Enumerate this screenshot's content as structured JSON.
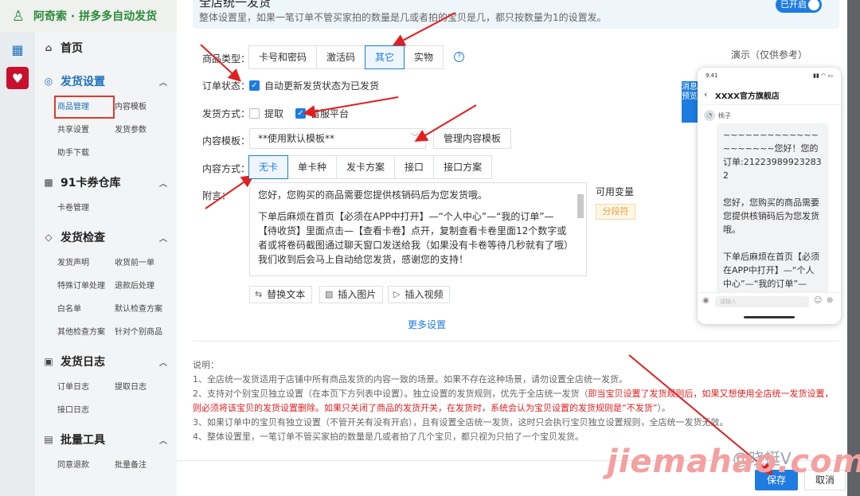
{
  "app": {
    "title": "阿奇索 · 拼多多自动发货"
  },
  "sidebar": {
    "home": "首页",
    "sections": [
      {
        "title": "发货设置",
        "items": [
          "商品管理",
          "内容模板",
          "共享设置",
          "发货参数",
          "助手下载"
        ]
      },
      {
        "title": "91卡券仓库",
        "items": [
          "卡卷管理"
        ]
      },
      {
        "title": "发货检查",
        "items": [
          "发货声明",
          "收货前一单",
          "特殊订单处理",
          "退款后处理",
          "白名单",
          "默认检查方案",
          "其他检查方案",
          "针对个别商品"
        ]
      },
      {
        "title": "发货日志",
        "items": [
          "订单日志",
          "提取日志",
          "接口日志"
        ]
      },
      {
        "title": "批量工具",
        "items": [
          "同意退款",
          "批量备注"
        ]
      }
    ]
  },
  "banner": {
    "title": "全店统一发货",
    "desc": "整体设置里，如果一笔订单不管买家拍的数量是几或者拍的宝贝是几，都只按数量为1的设置发。",
    "toggle_label": "已开启"
  },
  "form": {
    "product_type_label": "商品类型：",
    "product_types": [
      "卡号和密码",
      "激活码",
      "其它",
      "实物"
    ],
    "order_status_label": "订单状态：",
    "order_status_check": "自动更新发货状态为已发货",
    "ship_method_label": "发货方式：",
    "ship_opt1": "提取",
    "ship_opt2": "旨服平台",
    "template_label": "内容模板：",
    "template_value": "**使用默认模板**",
    "manage_btn": "管理内容模板",
    "content_mode_label": "内容方式：",
    "content_modes": [
      "无卡",
      "单卡种",
      "发卡方案",
      "接口",
      "接口方案"
    ],
    "note_label": "附言：",
    "note_lines": [
      "您好，您购买的商品需要您提供核销码后为您发货哦。",
      "下单后麻烦在首页【必须在APP中打开】—“个人中心”—“我的订单”—【待收货】里面点击—【查看卡卷】点开，复制查看卡卷里面12个数字或者或将卷码截图通过聊天窗口发送给我（如果没有卡卷等待几秒就有了哦）我们收到后会马上自动给您发货，感谢您的支持！"
    ],
    "var_label": "可用变量",
    "var_tag": "分段符",
    "tools": [
      "替换文本",
      "插入图片",
      "插入视频"
    ],
    "more": "更多设置"
  },
  "notes": {
    "title": "说明：",
    "n1": "1、全店统一发货适用于店铺中所有商品发货的内容一致的场景。如果不存在这种场景，请勿设置全店统一发货。",
    "n2a": "2、支持对个别宝贝独立设置（在本页下方列表中设置）。独立设置的发货规则，优先于全店统一发货（",
    "n2b": "即当宝贝设置了发货规则后，如果又想使用全店统一发货设置，则必须将该宝贝的发货设置删除。如果只关闭了商品的发货开关，在发货时，系统会认为宝贝设置的发货规则是“不发货”",
    "n2c": "）。",
    "n3": "3、如果订单中的宝贝有独立设置（不管开关有没有开启），且有设置全店统一发货，这时只会执行宝贝独立设置规则，全店统一发货无效。",
    "n4": "4、整体设置里，一笔订单不管买家拍的数量是几或者拍了几个宝贝，都只视为只拍了一个宝贝发货。"
  },
  "footer": {
    "save": "保存",
    "cancel": "取消"
  },
  "preview": {
    "label": "演示（仅供参考）",
    "tab": "消息预览",
    "time": "9:41",
    "shop": "XXXX官方旗舰店",
    "user": "桃子",
    "msg1": "~~~~~~~~~~~~~~~~~~~~您好！您的订单:212239899232832",
    "msg2": "您好，您购买的商品需要您提供核销码后为您发货哦。",
    "msg3": "下单后麻烦在首页【必须在APP中打开】—“个人中心”—“我的订单”—【待收货】里面点击",
    "input_placeholder": "请输入"
  },
  "watermark": {
    "text": "jiemahao.com",
    "small": "@晓蜓V"
  },
  "colors": {
    "primary": "#1e7ce0",
    "brand_green": "#2e8b3d",
    "annotation_red": "#e02020"
  }
}
